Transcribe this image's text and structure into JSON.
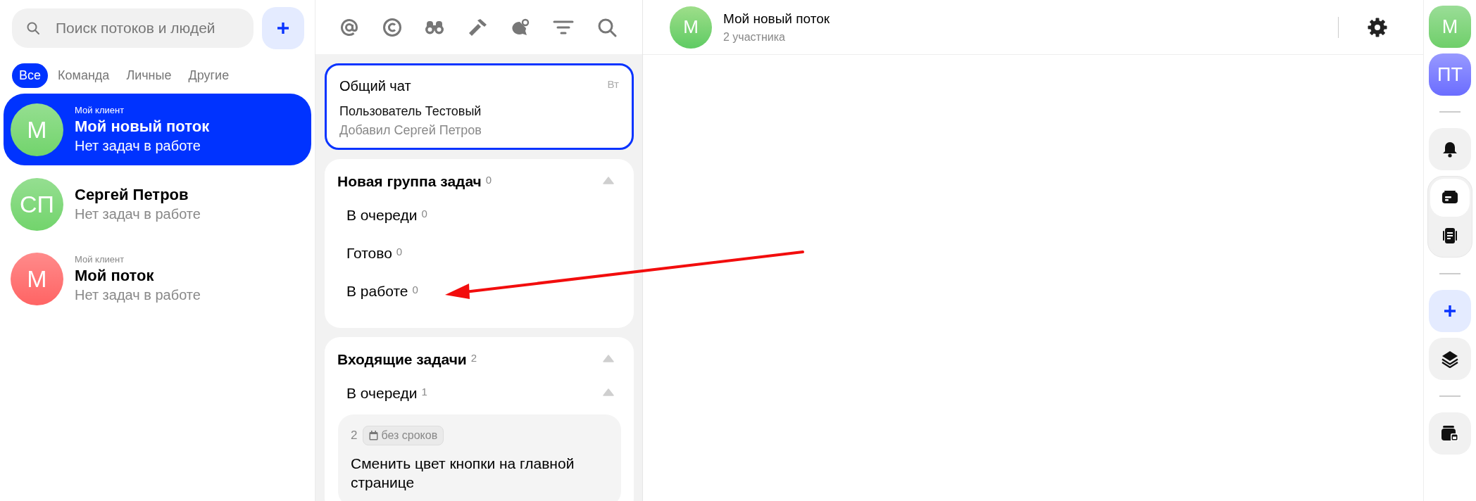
{
  "sidebar": {
    "search": {
      "placeholder": "Поиск потоков и людей"
    },
    "tabs": [
      {
        "label": "Все",
        "selected": true
      },
      {
        "label": "Команда",
        "selected": false
      },
      {
        "label": "Личные",
        "selected": false
      },
      {
        "label": "Другие",
        "selected": false
      }
    ],
    "threads": [
      {
        "tag": "Мой клиент",
        "title": "Мой новый поток",
        "subtitle": "Нет задач в работе",
        "initials": "М",
        "color": "#72d46c",
        "selected": true
      },
      {
        "title": "Сергей Петров",
        "subtitle": "Нет задач в работе",
        "initials": "СП",
        "color": "#72d46c",
        "selected": false
      },
      {
        "tag": "Мой клиент",
        "title": "Мой поток",
        "subtitle": "Нет задач в работе",
        "initials": "М",
        "color": "#ff6464",
        "selected": false
      }
    ]
  },
  "chat_card": {
    "title": "Общий чат",
    "time": "Вт",
    "line_1": "Пользователь Тестовый",
    "line_2": "Добавил Сергей Петров",
    "selected": true
  },
  "task_groups": [
    {
      "title": "Новая группа задач",
      "count": "0",
      "expanded": true,
      "statuses": [
        {
          "title": "В очереди",
          "count": "0"
        },
        {
          "title": "Готово",
          "count": "0"
        },
        {
          "title": "В работе",
          "count": "0"
        }
      ]
    },
    {
      "title": "Входящие задачи",
      "count": "2",
      "expanded": true,
      "statuses": [
        {
          "title": "В очереди",
          "count": "1",
          "expanded": true,
          "tasks": [
            {
              "number": "2",
              "due": "без сроков",
              "title": "Сменить цвет кнопки на главной странице"
            }
          ]
        }
      ]
    }
  ],
  "header": {
    "initials": "М",
    "title": "Мой новый поток",
    "subtitle": "2 участника"
  },
  "rail": [
    {
      "kind": "avatar",
      "initials": "М",
      "color": "#6fcf6a"
    },
    {
      "kind": "avatar",
      "initials": "ПТ",
      "color": "#6b6dff"
    },
    {
      "kind": "separator"
    },
    {
      "kind": "bell"
    },
    {
      "kind": "pair",
      "views": [
        {
          "selected": true
        },
        {
          "selected": false
        }
      ]
    },
    {
      "kind": "separator"
    },
    {
      "kind": "plus"
    },
    {
      "kind": "layers"
    },
    {
      "kind": "separator"
    },
    {
      "kind": "wallet"
    }
  ]
}
